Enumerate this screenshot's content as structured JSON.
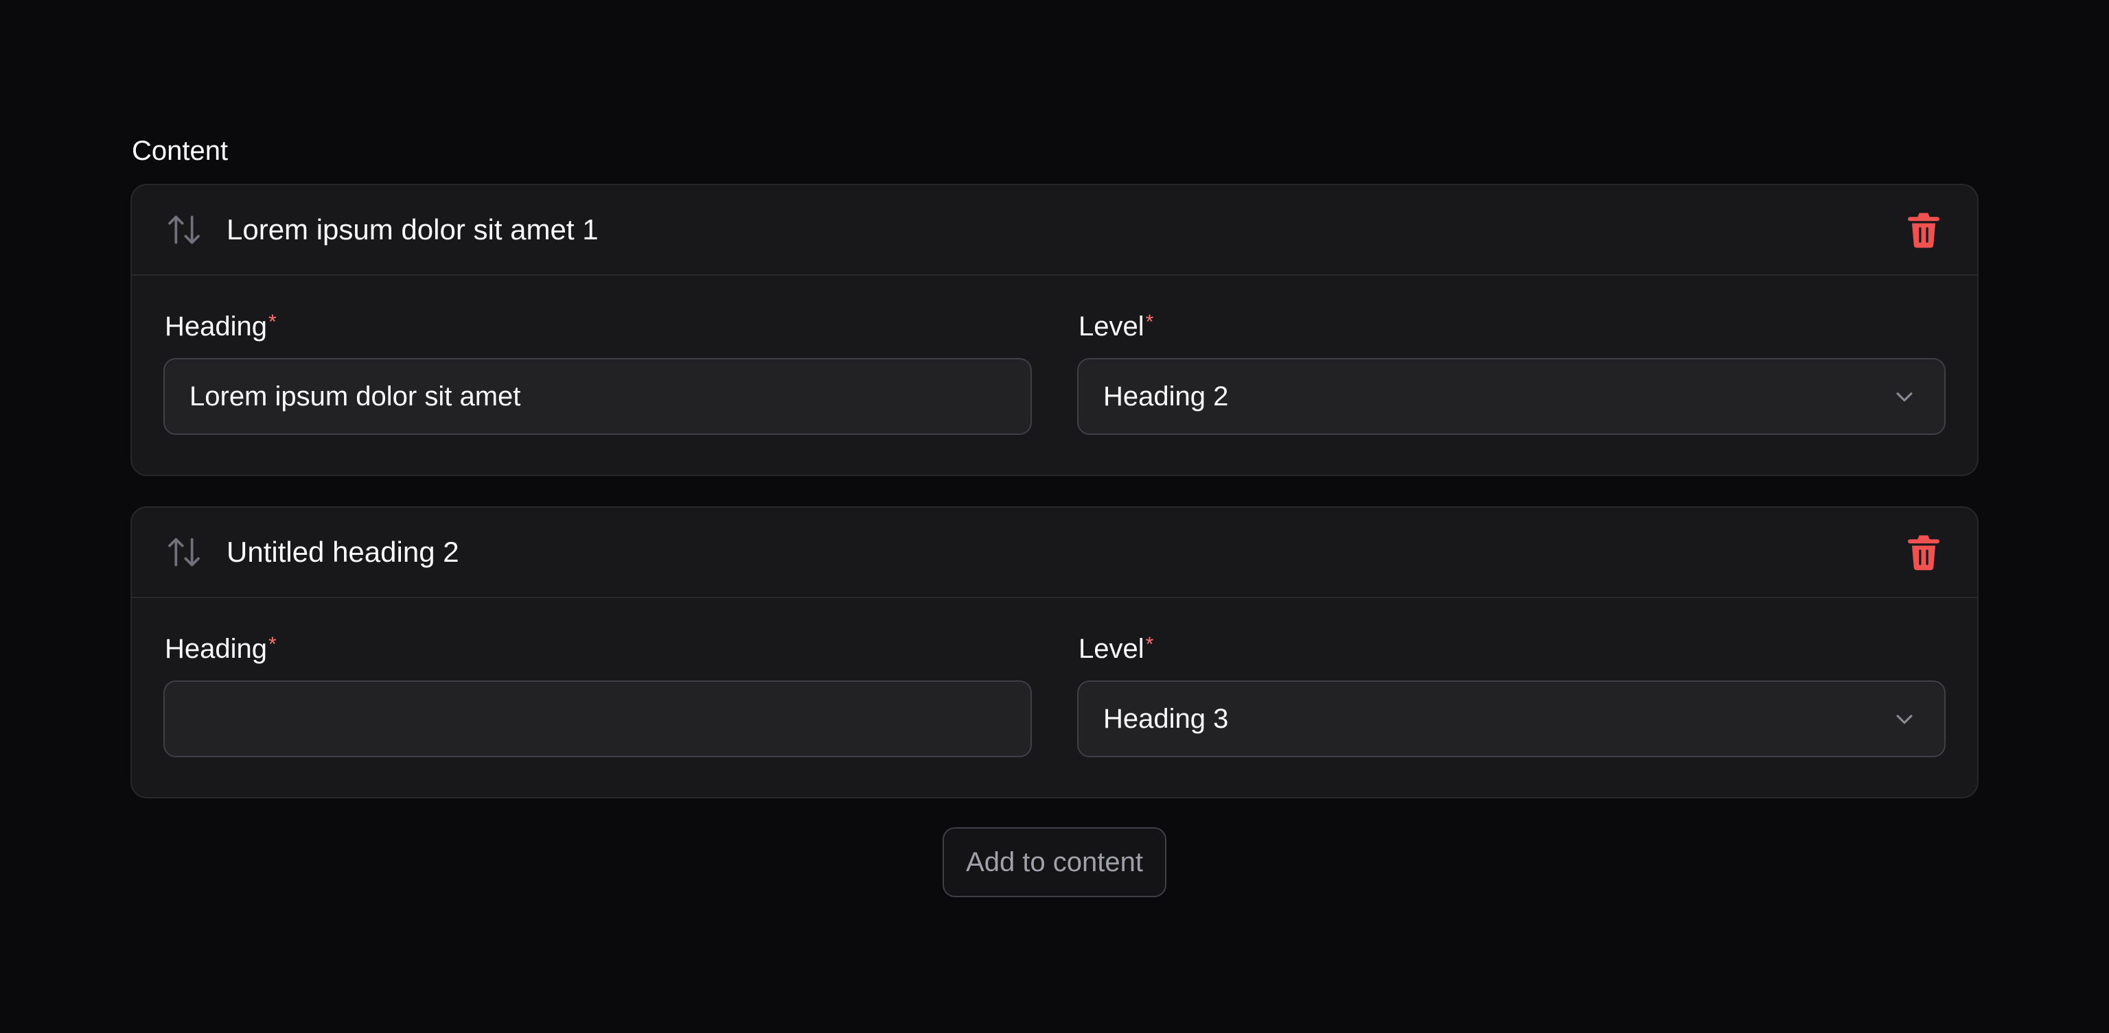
{
  "section": {
    "label": "Content"
  },
  "items": [
    {
      "title": "Lorem ipsum dolor sit amet 1",
      "heading_label": "Heading",
      "heading_value": "Lorem ipsum dolor sit amet",
      "level_label": "Level",
      "level_value": "Heading 2",
      "required_mark": "*"
    },
    {
      "title": "Untitled heading 2",
      "heading_label": "Heading",
      "heading_value": "",
      "level_label": "Level",
      "level_value": "Heading 3",
      "required_mark": "*"
    }
  ],
  "actions": {
    "add_label": "Add to content"
  },
  "icons": {
    "reorder": "arrows-up-down-icon",
    "delete": "trash-icon",
    "dropdown": "chevron-down-icon"
  },
  "colors": {
    "background": "#0a0a0c",
    "card": "#18181b",
    "danger": "#f05252",
    "required": "#f87171"
  }
}
